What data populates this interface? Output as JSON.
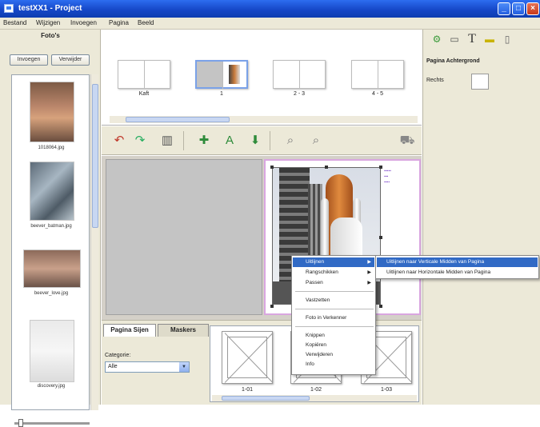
{
  "window": {
    "title": "testXX1 - Project"
  },
  "menubar": [
    "Bestand",
    "Wijzigen",
    "Invoegen",
    "Pagina",
    "Beeld"
  ],
  "left_panel": {
    "header": "Foto's",
    "insert_button": "Invoegen",
    "remove_button": "Verwijder",
    "photos": [
      {
        "caption": "1018064.jpg"
      },
      {
        "caption": "beever_batman.jpg"
      },
      {
        "caption": "beever_love.jpg"
      },
      {
        "caption": "discovery.jpg"
      }
    ]
  },
  "page_strip": {
    "spreads": [
      {
        "label": "Kaft"
      },
      {
        "label": "1"
      },
      {
        "label": "2 - 3"
      },
      {
        "label": "4 - 5"
      }
    ]
  },
  "bottom": {
    "tabs": [
      "Pagina Sijen",
      "Maskers"
    ],
    "category_label": "Categorie:",
    "category_value": "Alle",
    "layouts": [
      "1-01",
      "1-02",
      "1-03"
    ]
  },
  "right_panel": {
    "title": "Pagina Achtergrond",
    "label": "Rechts"
  },
  "context_menu": {
    "items": [
      "Uitlijnen",
      "Rangschikken",
      "Passen",
      "Vastzetten",
      "Foto in Verkenner",
      "Knippen",
      "Kopiëren",
      "Verwijderen",
      "Info"
    ],
    "submenu": [
      "Uitlijnen naar Verticale Midden van Pagina",
      "Uitlijnen naar Horizontale Midden van Pagina"
    ]
  },
  "colors": {
    "title_bar": "#1648c8",
    "highlight": "#316ac5",
    "page_border": "#d9a6e0"
  }
}
